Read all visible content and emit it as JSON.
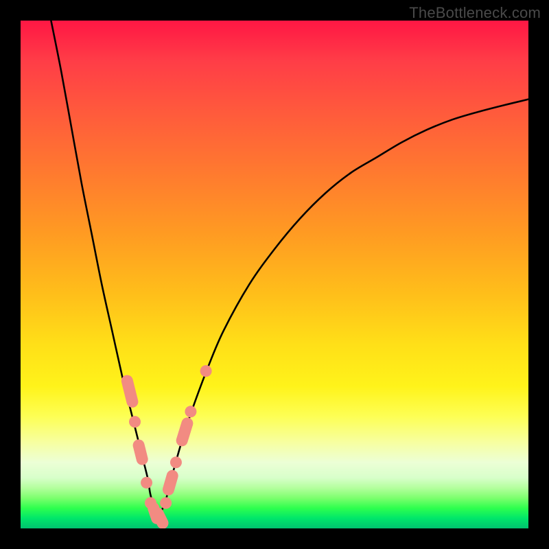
{
  "watermark": "TheBottleneck.com",
  "chart_data": {
    "type": "line",
    "title": "",
    "xlabel": "",
    "ylabel": "",
    "xlim": [
      0,
      100
    ],
    "ylim": [
      0,
      100
    ],
    "note": "Unlabeled V-shaped bottleneck curve over a red-to-green gradient. No numeric axes are visible; values below are positional estimates in 0-100 plot coordinates (origin at bottom-left).",
    "series": [
      {
        "name": "left-branch",
        "x": [
          6,
          8,
          10,
          12,
          14,
          16,
          18,
          20,
          21,
          22,
          23,
          24,
          25,
          25.5,
          26,
          26.5,
          27
        ],
        "y": [
          100,
          90,
          79,
          68,
          58,
          48,
          39,
          30,
          26,
          22,
          18,
          14,
          10,
          7,
          5,
          3,
          2
        ]
      },
      {
        "name": "right-branch",
        "x": [
          27,
          28,
          29,
          30,
          32,
          34,
          37,
          40,
          45,
          50,
          55,
          60,
          65,
          70,
          75,
          80,
          85,
          90,
          95,
          100
        ],
        "y": [
          2,
          4,
          7,
          11,
          18,
          24,
          32,
          39,
          48,
          55,
          61,
          66,
          70,
          73,
          76,
          78.5,
          80.5,
          82,
          83.3,
          84.5
        ]
      }
    ],
    "markers": {
      "name": "highlighted-points",
      "color": "#f28b82",
      "note": "Soft-pink dots and short capsules clustered near the V-minimum on both branches. Coordinates are estimates in 0-100 plot space.",
      "points": [
        {
          "x": 21.5,
          "y": 27,
          "kind": "capsule",
          "len": 6
        },
        {
          "x": 22.5,
          "y": 21,
          "kind": "dot"
        },
        {
          "x": 23.6,
          "y": 15,
          "kind": "capsule",
          "len": 4
        },
        {
          "x": 24.8,
          "y": 9,
          "kind": "dot"
        },
        {
          "x": 25.6,
          "y": 5,
          "kind": "dot"
        },
        {
          "x": 26.5,
          "y": 3,
          "kind": "capsule",
          "len": 3
        },
        {
          "x": 27.5,
          "y": 2,
          "kind": "capsule",
          "len": 3
        },
        {
          "x": 28.6,
          "y": 5,
          "kind": "dot"
        },
        {
          "x": 29.5,
          "y": 9,
          "kind": "capsule",
          "len": 4
        },
        {
          "x": 30.6,
          "y": 13,
          "kind": "dot"
        },
        {
          "x": 32.3,
          "y": 19,
          "kind": "capsule",
          "len": 5
        },
        {
          "x": 33.5,
          "y": 23,
          "kind": "dot"
        },
        {
          "x": 36.5,
          "y": 31,
          "kind": "dot"
        }
      ]
    }
  }
}
